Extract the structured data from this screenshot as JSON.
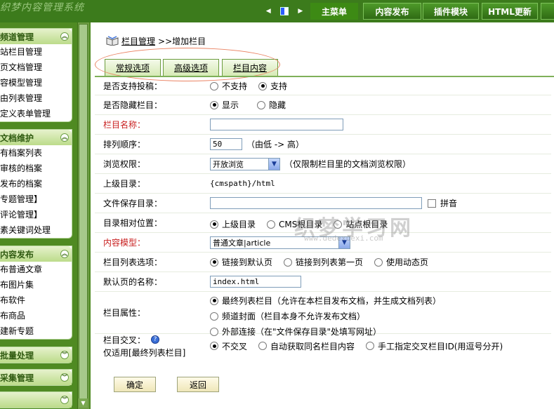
{
  "header": {
    "logo_text": "织梦内容管理系统",
    "nav": [
      "主菜单",
      "内容发布",
      "插件模块",
      "HTML更新",
      ""
    ]
  },
  "sidebar": {
    "groups": [
      {
        "title": "频道管理",
        "items": [
          "站栏目管理",
          "页文档管理",
          "容模型管理",
          "由列表管理",
          "定义表单管理"
        ]
      },
      {
        "title": "文档维护",
        "items": [
          "有档案列表",
          "审核的档案",
          "发布的档案",
          "专题管理】",
          "评论管理】",
          "素关键词处理"
        ]
      },
      {
        "title": "内容发布",
        "items": [
          "布普通文章",
          "布图片集",
          "布软件",
          "布商品",
          "建新专题"
        ]
      },
      {
        "title": "批量处理",
        "items": []
      },
      {
        "title": "采集管理",
        "items": []
      },
      {
        "title": "",
        "items": []
      }
    ]
  },
  "breadcrumb": {
    "link": "栏目管理",
    "rest": ">>增加栏目"
  },
  "tabs": [
    "常规选项",
    "高级选项",
    "栏目内容"
  ],
  "form": {
    "allow_submit": {
      "label": "是否支持投稿：",
      "options": [
        "不支持",
        "支持"
      ]
    },
    "hide_column": {
      "label": "是否隐藏栏目：",
      "options": [
        "显示",
        "隐藏"
      ]
    },
    "column_name": {
      "label": "栏目名称：",
      "value": ""
    },
    "sort_order": {
      "label": "排列顺序：",
      "value": "50",
      "hint": "（由低 -> 高）"
    },
    "browse_perm": {
      "label": "浏览权限：",
      "selected": "开放浏览",
      "hint": "（仅限制栏目里的文档浏览权限）"
    },
    "parent_dir": {
      "label": "上级目录：",
      "value": "{cmspath}/html"
    },
    "save_dir": {
      "label": "文件保存目录：",
      "value": "",
      "pinyin": "拼音"
    },
    "relative_pos": {
      "label": "目录相对位置：",
      "options": [
        "上级目录",
        "CMS根目录",
        "站点根目录"
      ]
    },
    "content_model": {
      "label": "内容模型：",
      "selected": "普通文章|article"
    },
    "list_option": {
      "label": "栏目列表选项：",
      "options": [
        "链接到默认页",
        "链接到列表第一页",
        "使用动态页"
      ]
    },
    "default_page": {
      "label": "默认页的名称：",
      "value": "index.html"
    },
    "attributes": {
      "label": "栏目属性：",
      "options": [
        "最终列表栏目（允许在本栏目发布文档，并生成文档列表）",
        "频道封面（栏目本身不允许发布文档）",
        "外部连接（在\"文件保存目录\"处填写网址）"
      ]
    },
    "cross": {
      "label": "栏目交叉：",
      "label2": "仅适用[最终列表栏目]",
      "options": [
        "不交叉",
        "自动获取同名栏目内容",
        "手工指定交叉栏目ID(用逗号分开)"
      ]
    }
  },
  "watermark": {
    "main": "织梦学习网",
    "sub": "www.dedexuexi.com"
  },
  "buttons": {
    "ok": "确定",
    "back": "返回"
  }
}
